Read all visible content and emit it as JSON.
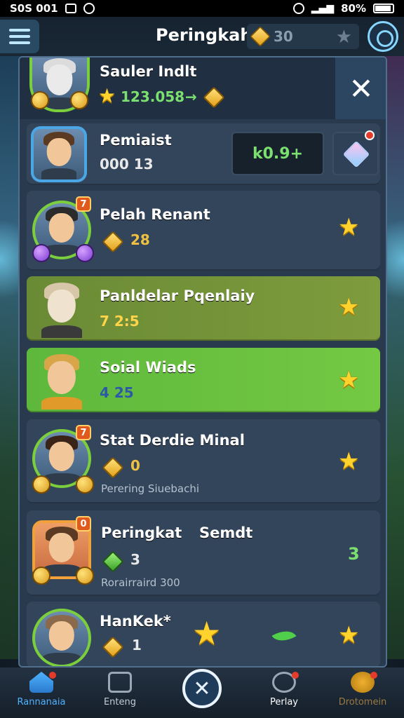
{
  "status_bar": {
    "time": "S0S 001",
    "battery": "80%"
  },
  "header": {
    "title": "Peringkah",
    "gold": "30"
  },
  "top_player": {
    "name": "Sauler Indlt",
    "score": "123.058"
  },
  "players": [
    {
      "name": "Pemiaist",
      "stat": "000 13",
      "bonus": "k0.9+"
    },
    {
      "name": "Pelah Renant",
      "stat": "28",
      "rank_badge": "7"
    },
    {
      "name": "Panldelar Pqenlaiy",
      "stat": "7 2:5"
    },
    {
      "name": "Soial Wiads",
      "stat": "4 25"
    },
    {
      "name": "Stat Derdie Minal",
      "stat": "0",
      "caption": "Perering Siuebachi",
      "rank_badge": "7"
    },
    {
      "name": "Peringkat",
      "name_suffix": "Semdt",
      "stat": "3",
      "caption": "Rorairraird 300",
      "count": "3",
      "rank_badge": "0"
    },
    {
      "name": "HanKek*",
      "stat": "1"
    }
  ],
  "nav": {
    "home": "Rannanaia",
    "events": "Enteng",
    "profile": "Perlay",
    "rewards": "Drotomein"
  },
  "colors": {
    "accent_green": "#7be070",
    "gold": "#ffd22e",
    "panel": "#2a3a4e"
  }
}
